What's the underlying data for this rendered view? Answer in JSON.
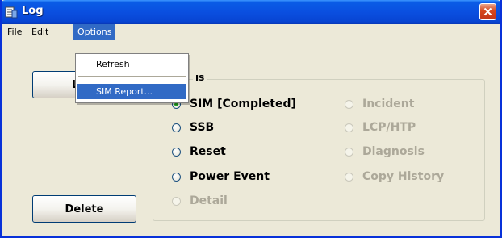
{
  "window": {
    "title": "Log",
    "close_label": "✕"
  },
  "menubar": {
    "items": [
      "File",
      "Edit",
      "Options"
    ],
    "active": "Options"
  },
  "options_menu": {
    "items": [
      "Refresh",
      "SIM Report..."
    ],
    "highlighted": "SIM Report..."
  },
  "buttons": {
    "list_label": "Li",
    "delete_label": "Delete"
  },
  "group": {
    "legend_partial": "ıs"
  },
  "radios": {
    "left": [
      {
        "label": "SIM [Completed]",
        "checked": true,
        "enabled": true
      },
      {
        "label": "SSB",
        "checked": false,
        "enabled": true
      },
      {
        "label": "Reset",
        "checked": false,
        "enabled": true
      },
      {
        "label": "Power Event",
        "checked": false,
        "enabled": true
      },
      {
        "label": "Detail",
        "checked": false,
        "enabled": false
      }
    ],
    "right": [
      {
        "label": "Incident",
        "checked": false,
        "enabled": false
      },
      {
        "label": "LCP/HTP",
        "checked": false,
        "enabled": false
      },
      {
        "label": "Diagnosis",
        "checked": false,
        "enabled": false
      },
      {
        "label": "Copy History",
        "checked": false,
        "enabled": false
      }
    ]
  },
  "colors": {
    "titlebar": "#0a4fe0",
    "menu_highlight": "#316ac5",
    "window_bg": "#ece9d8",
    "disabled_text": "#aca899",
    "close_button": "#d5471c"
  }
}
